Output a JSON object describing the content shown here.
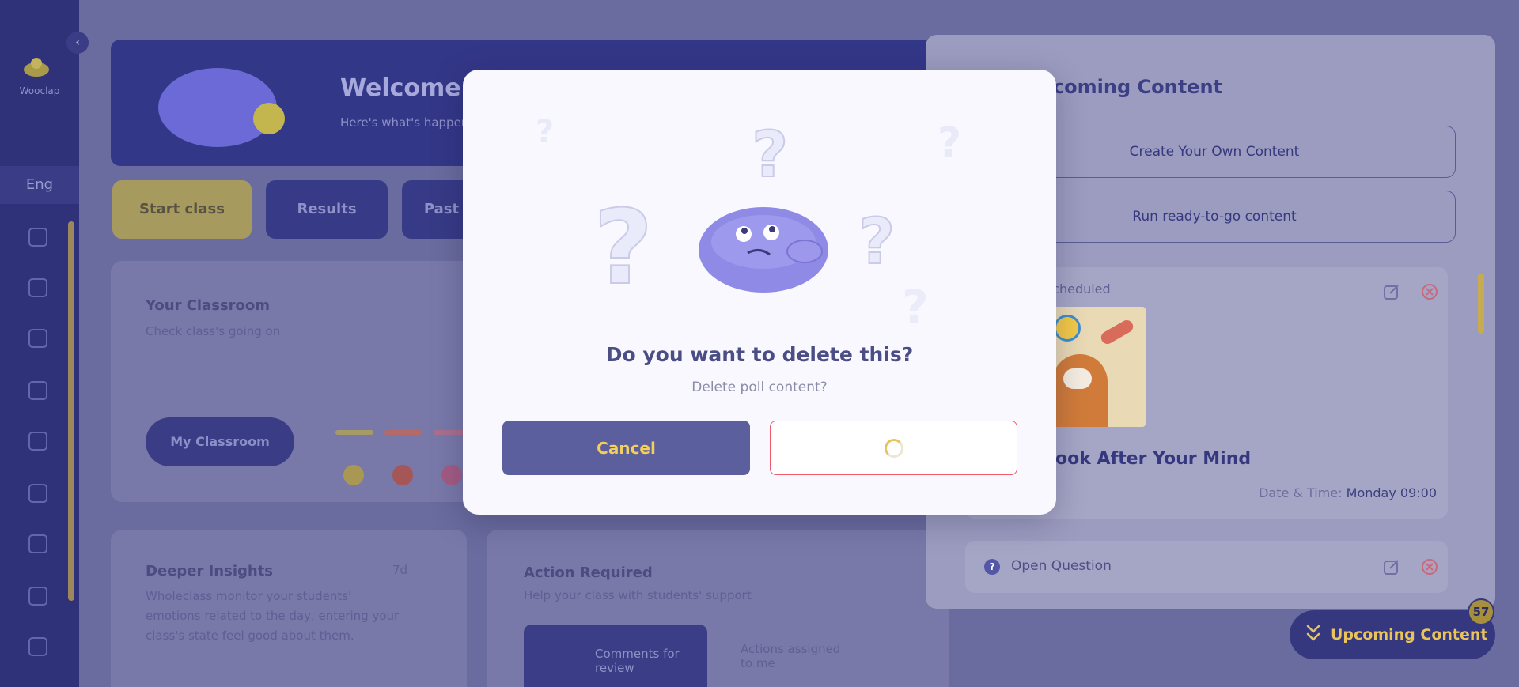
{
  "sidebar": {
    "brand": "Wooclap",
    "section_label": "Eng"
  },
  "banner": {
    "title": "Welcome back!",
    "subtitle": "Here's what's happening in your class"
  },
  "tabs": [
    "Start class",
    "Results",
    "Past"
  ],
  "classroom_card": {
    "title": "Your Classroom",
    "subtitle": "Check class's going on",
    "button_label": "My Classroom"
  },
  "insights_card": {
    "title": "Deeper Insights",
    "period": "7d",
    "body": "Wholeclass monitor your students' emotions related to the day, entering your class's state feel good about them."
  },
  "action_card": {
    "title": "Action Required",
    "subtitle": "Help your class with students' support",
    "box_label": "Comments for review",
    "note": "Actions assigned to me"
  },
  "upcoming_panel": {
    "title": "Upcoming Content",
    "create_button": "Create Your Own Content",
    "ready_button": "Run ready-to-go content",
    "item1": {
      "status": "Scheduled",
      "title": "Look After Your Mind",
      "date_label": "Date & Time:",
      "date_value": "Monday 09:00"
    },
    "item2": {
      "type_label": "Open Question"
    }
  },
  "upcoming_toggle": {
    "label": "Upcoming Content",
    "count": "57"
  },
  "modal": {
    "title": "Do you want to delete this?",
    "subtitle": "Delete poll content?",
    "cancel_label": "Cancel",
    "confirm_state": "loading"
  },
  "colors": {
    "accent_yellow": "#e9c45a",
    "primary_indigo": "#5c5f9d",
    "danger_red": "#ef5b6d",
    "sidebar": "#2f3279"
  }
}
